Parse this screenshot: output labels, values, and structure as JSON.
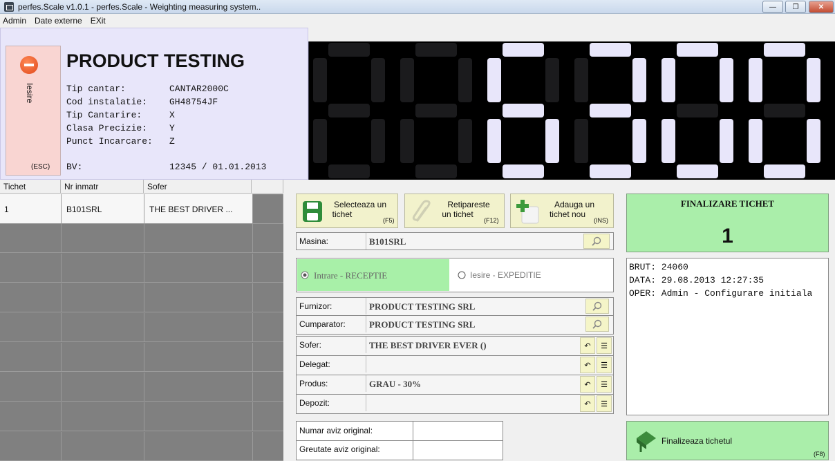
{
  "window": {
    "title": "perfes.Scale v1.0.1 - perfes.Scale - Weighting measuring system.."
  },
  "menu": [
    "Admin",
    "Date externe",
    "EXit"
  ],
  "header": {
    "exit_label": "Iesire",
    "exit_key": "(ESC)",
    "title": "PRODUCT TESTING",
    "info": [
      {
        "label": "Tip cantar:",
        "value": "CANTAR2000C"
      },
      {
        "label": "Cod instalatie:",
        "value": "GH48754JF"
      },
      {
        "label": "Tip Cantarire:",
        "value": "X"
      },
      {
        "label": "Clasa Precizie:",
        "value": "Y"
      },
      {
        "label": "Punct Incarcare:",
        "value": "Z"
      }
    ],
    "bv_label": "BV:",
    "bv_value": "12345 / 01.01.2013"
  },
  "display": {
    "weight": "6300",
    "digit_count": 6,
    "color_on": "#e8e6fa",
    "color_off": "#1b1b1d"
  },
  "grid": {
    "columns": [
      "Tichet",
      "Nr inmatr",
      "Sofer"
    ],
    "rows": [
      [
        "1",
        "B101SRL",
        "THE BEST DRIVER ..."
      ]
    ]
  },
  "toolbar": {
    "select": {
      "line1": "Selecteaza un",
      "line2": "tichet",
      "key": "(F5)"
    },
    "reprint": {
      "line1": "Retipareste",
      "line2": "un tichet",
      "key": "(F12)"
    },
    "add": {
      "line1": "Adauga un",
      "line2": "tichet nou",
      "key": "(INS)"
    }
  },
  "form": {
    "masina": {
      "label": "Masina:",
      "value": "B101SRL"
    },
    "direction": {
      "in": "Intrare - RECEPTIE",
      "out": "Iesire - EXPEDITIE",
      "selected": "in"
    },
    "furnizor": {
      "label": "Furnizor:",
      "value": "PRODUCT TESTING SRL"
    },
    "cumparator": {
      "label": "Cumparator:",
      "value": "PRODUCT TESTING SRL"
    },
    "sofer": {
      "label": "Sofer:",
      "value": "THE BEST DRIVER EVER ()"
    },
    "delegat": {
      "label": "Delegat:",
      "value": ""
    },
    "produs": {
      "label": "Produs:",
      "value": "GRAU - 30%"
    },
    "depozit": {
      "label": "Depozit:",
      "value": ""
    },
    "aviz_numar": {
      "label": "Numar aviz original:",
      "value": ""
    },
    "aviz_greutate": {
      "label": "Greutate aviz original:",
      "value": ""
    }
  },
  "final": {
    "header": "FINALIZARE TICHET",
    "ticket_number": "1",
    "log": [
      "BRUT: 24060",
      "DATA: 29.08.2013 12:27:35",
      "OPER: Admin - Configurare initiala"
    ],
    "button_label": "Finalizeaza tichetul",
    "button_key": "(F8)"
  }
}
